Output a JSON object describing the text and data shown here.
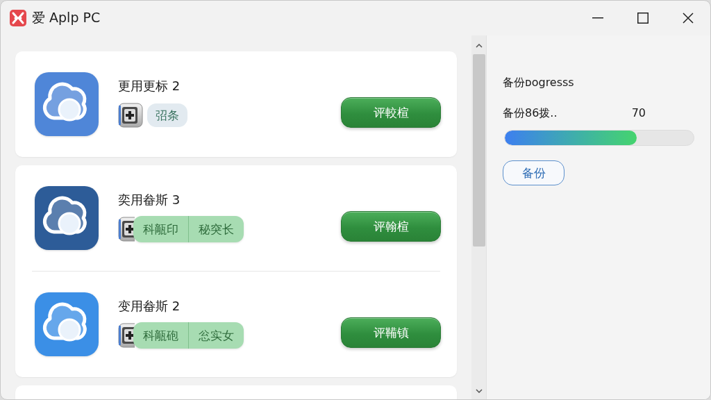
{
  "window": {
    "title": "爱 Aplp PC"
  },
  "cards": [
    {
      "apps": [
        {
          "name": "更用更标 2",
          "kind": "plain",
          "color": "#4f86d8",
          "tags": [
            "弨条"
          ],
          "button": "评較楦"
        }
      ]
    },
    {
      "apps": [
        {
          "name": "奕用畚斯 3",
          "kind": "grouped",
          "color": "#2d5c98",
          "tags": [
            "科甋印",
            "秘突长"
          ],
          "button": "评翰楦"
        },
        {
          "name": "变用畚斯 2",
          "kind": "grouped",
          "color": "#3b8fe6",
          "tags": [
            "科甋砲",
            "忩实女"
          ],
          "button": "评鞴镇"
        }
      ]
    }
  ],
  "progress_panel": {
    "heading": "备份ᴅogresss",
    "label": "备份86拨..",
    "reading": "70",
    "level": 0.7,
    "button": "备份"
  }
}
